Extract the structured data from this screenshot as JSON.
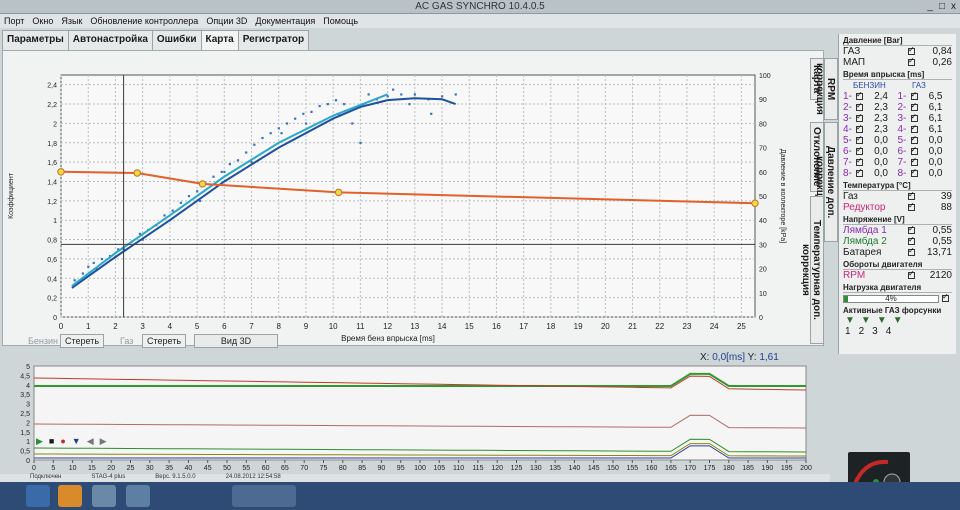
{
  "window": {
    "title": "AC GAS SYNCHRO  10.4.0.5",
    "controls": [
      "_",
      "□",
      "x"
    ]
  },
  "menu": [
    "Порт",
    "Окно",
    "Язык",
    "Обновление контроллера",
    "Опции 3D",
    "Документация",
    "Помощь"
  ],
  "tabs": [
    "Параметры",
    "Автонастройка",
    "Ошибки",
    "Карта",
    "Регистратор"
  ],
  "side_tabs": [
    "Карта",
    "RPM коррекция",
    "Отклонение",
    "Давление доп. коррекция",
    "Температурная доп. коррекция"
  ],
  "controls": {
    "benzin": "Бензин",
    "benzin_clear": "Стереть",
    "gaz": "Газ",
    "gaz_clear": "Стереть",
    "view3d": "Вид 3D"
  },
  "readout": {
    "x_label": "X:",
    "x_value": "0,0[ms]",
    "y_label": "Y:",
    "y_value": "1,61"
  },
  "status_bar": [
    "Подключен",
    "STAG-4 plus",
    "Верс. 9.1.5.0.0",
    "24.08.2012 12:54:58"
  ],
  "panel": {
    "pressure_header": "Давление [Bar]",
    "gas_label": "ГАЗ",
    "gas_value": "0,84",
    "map_label": "МАП",
    "map_value": "0,26",
    "injection_header": "Время впрыска [ms]",
    "col_benzin": "БЕНЗИН",
    "col_gas": "ГАЗ",
    "injectors": [
      {
        "n": "1",
        "benzin": "2,4",
        "gas": "6,5"
      },
      {
        "n": "2",
        "benzin": "2,3",
        "gas": "6,1"
      },
      {
        "n": "3",
        "benzin": "2,3",
        "gas": "6,1"
      },
      {
        "n": "4",
        "benzin": "2,3",
        "gas": "6,1"
      },
      {
        "n": "5",
        "benzin": "0,0",
        "gas": "0,0"
      },
      {
        "n": "6",
        "benzin": "0,0",
        "gas": "0,0"
      },
      {
        "n": "7",
        "benzin": "0,0",
        "gas": "0,0"
      },
      {
        "n": "8",
        "benzin": "0,0",
        "gas": "0,0"
      }
    ],
    "temp_header": "Температура [°C]",
    "temp_gas_label": "Газ",
    "temp_gas_value": "39",
    "temp_red_label": "Редуктор",
    "temp_red_value": "88",
    "voltage_header": "Напряжение [V]",
    "lambda1_label": "Лямбда 1",
    "lambda1_value": "0,55",
    "lambda2_label": "Лямбда 2",
    "lambda2_value": "0,55",
    "battery_label": "Батарея",
    "battery_value": "13,71",
    "rpm_header": "Обороты двигателя",
    "rpm_label": "RPM",
    "rpm_value": "2120",
    "load_header": "Нагрузка двигателя",
    "load_value": "4%",
    "load_level": 0.04,
    "active_header": "Активные ГАЗ форсунки",
    "active_nums": [
      "1",
      "2",
      "3",
      "4"
    ]
  },
  "chart_data": {
    "type": "scatter",
    "xlabel": "Время бенз впрыска [ms]",
    "ylabel": "Коэффициент",
    "y2label": "Давление в коллекторе [kPa]",
    "xlim": [
      0,
      25.5
    ],
    "ylim": [
      0,
      2.5
    ],
    "y2lim": [
      0,
      100
    ],
    "xticks": [
      "0",
      "1",
      "2",
      "3",
      "4",
      "5",
      "6",
      "7",
      "8",
      "9",
      "10",
      "11",
      "12",
      "13",
      "14",
      "15",
      "16",
      "17",
      "18",
      "19",
      "20",
      "21",
      "22",
      "23",
      "24",
      "25"
    ],
    "yticks": [
      "0",
      "0,2",
      "0,4",
      "0,6",
      "0,8",
      "1",
      "1,2",
      "1,4",
      "1,6",
      "1,8",
      "2",
      "2,2",
      "2,4"
    ],
    "y2ticks": [
      "0",
      "10",
      "20",
      "30",
      "40",
      "50",
      "60",
      "70",
      "80",
      "90",
      "100"
    ],
    "grid": true,
    "series": [
      {
        "type": "scatter",
        "color": "#3a6fc2",
        "x": [
          0.5,
          0.8,
          1.0,
          1.2,
          1.5,
          1.8,
          2.0,
          2.3,
          2.6,
          2.9,
          3.2,
          3.5,
          3.8,
          4.1,
          4.4,
          4.7,
          5.0,
          5.3,
          5.6,
          5.9,
          6.2,
          6.5,
          6.8,
          7.1,
          7.4,
          7.7,
          8.0,
          8.3,
          8.6,
          8.9,
          9.2,
          9.5,
          9.8,
          10.1,
          10.4,
          10.7,
          11.0,
          11.3,
          11.6,
          12.0,
          12.5,
          13.0,
          13.5,
          14.0,
          14.5,
          1.3,
          2.1,
          3.0,
          4.0,
          5.1,
          6.0,
          7.0,
          8.1,
          9.0,
          10.2,
          11.1,
          12.2,
          12.8,
          13.6
        ],
        "y": [
          0.38,
          0.45,
          0.52,
          0.56,
          0.6,
          0.63,
          0.62,
          0.7,
          0.78,
          0.86,
          0.9,
          0.95,
          1.05,
          1.1,
          1.18,
          1.25,
          1.3,
          1.38,
          1.45,
          1.5,
          1.58,
          1.62,
          1.7,
          1.78,
          1.85,
          1.9,
          1.95,
          2.0,
          2.05,
          2.1,
          2.12,
          2.18,
          2.2,
          2.24,
          2.2,
          2.0,
          1.8,
          2.3,
          2.25,
          2.28,
          2.3,
          2.3,
          2.25,
          2.28,
          2.3,
          0.5,
          0.7,
          0.8,
          1.0,
          1.2,
          1.5,
          1.6,
          1.9,
          2.0,
          2.1,
          2.2,
          2.35,
          2.2,
          2.1
        ]
      },
      {
        "type": "line",
        "color": "#1f4f9e",
        "name_hidden": true,
        "x": [
          0.4,
          2,
          4,
          6,
          8,
          10,
          11,
          12,
          13,
          14,
          14.5
        ],
        "y": [
          0.3,
          0.62,
          1.0,
          1.4,
          1.75,
          2.05,
          2.17,
          2.24,
          2.26,
          2.25,
          2.2
        ]
      },
      {
        "type": "line",
        "color": "#2aa8c9",
        "x": [
          0.4,
          2,
          4,
          6,
          8,
          10,
          12
        ],
        "y": [
          0.32,
          0.66,
          1.05,
          1.45,
          1.8,
          2.08,
          2.3
        ]
      },
      {
        "type": "line",
        "color": "#e2602c",
        "axis": "y2",
        "x": [
          0,
          2.8,
          5.2,
          10.2,
          25.5
        ],
        "y": [
          60,
          59.5,
          55,
          51.5,
          47
        ],
        "markers": [
          0,
          1,
          2,
          3,
          4
        ]
      },
      {
        "type": "hline",
        "color": "#3b3b3b",
        "axis": "y2",
        "y": 30
      },
      {
        "type": "vline",
        "color": "#3b3b3b",
        "x": 2.3
      }
    ]
  },
  "lower_chart": {
    "xticks": [
      "0",
      "5",
      "10",
      "15",
      "20",
      "25",
      "30",
      "35",
      "40",
      "45",
      "50",
      "55",
      "60",
      "65",
      "70",
      "75",
      "80",
      "85",
      "90",
      "95",
      "100",
      "105",
      "110",
      "115",
      "120",
      "125",
      "130",
      "135",
      "140",
      "145",
      "150",
      "155",
      "160",
      "165",
      "170",
      "175",
      "180",
      "185",
      "190",
      "195",
      "200"
    ],
    "yticks": [
      "5",
      "4,5",
      "4",
      "3,5",
      "3",
      "2,5",
      "2",
      "1,5",
      "1",
      "0,5",
      "0"
    ]
  }
}
